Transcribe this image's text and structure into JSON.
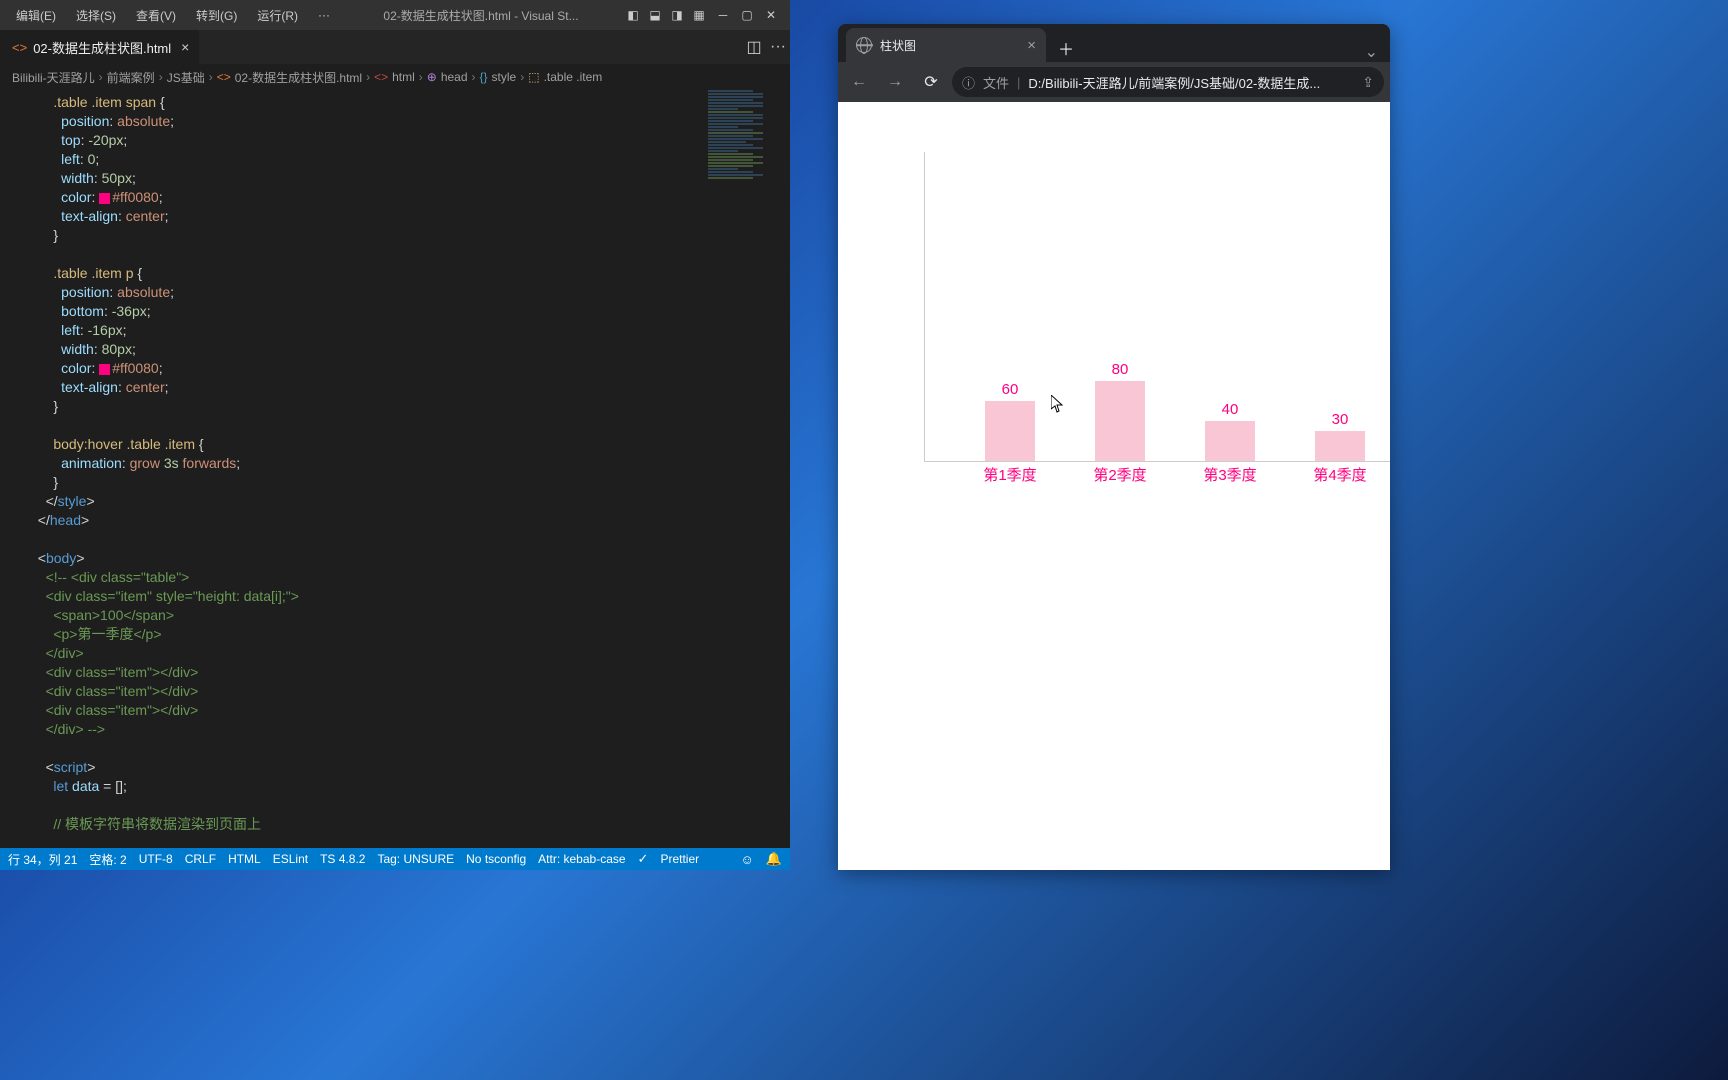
{
  "vscode": {
    "menu": [
      "编辑(E)",
      "选择(S)",
      "查看(V)",
      "转到(G)",
      "运行(R)"
    ],
    "menu_more": "···",
    "title": "02-数据生成柱状图.html - Visual St...",
    "tab": {
      "icon": "<>",
      "name": "02-数据生成柱状图.html"
    },
    "breadcrumb": [
      {
        "icon": "",
        "text": "Bilibili-天涯路儿"
      },
      {
        "icon": "",
        "text": "前端案例"
      },
      {
        "icon": "",
        "text": "JS基础"
      },
      {
        "icon": "<>",
        "cls": "ic-orange",
        "text": "02-数据生成柱状图.html"
      },
      {
        "icon": "<>",
        "cls": "ic-red",
        "text": "html"
      },
      {
        "icon": "⊕",
        "cls": "ic-purple",
        "text": "head"
      },
      {
        "icon": "{}",
        "cls": "ic-blue",
        "text": "style"
      },
      {
        "icon": "⬚",
        "cls": "ic-yellow",
        "text": ".table .item"
      }
    ],
    "code_lines": [
      "      <span class='tok-sel'>.table .item span</span> <span class='tok-punc'>{</span>",
      "        <span class='tok-prop'>position</span><span class='tok-punc'>:</span> <span class='tok-val'>absolute</span><span class='tok-punc'>;</span>",
      "        <span class='tok-prop'>top</span><span class='tok-punc'>:</span> <span class='tok-num'>-20px</span><span class='tok-punc'>;</span>",
      "        <span class='tok-prop'>left</span><span class='tok-punc'>:</span> <span class='tok-num'>0</span><span class='tok-punc'>;</span>",
      "        <span class='tok-prop'>width</span><span class='tok-punc'>:</span> <span class='tok-num'>50px</span><span class='tok-punc'>;</span>",
      "        <span class='tok-prop'>color</span><span class='tok-punc'>:</span> <span class='cswatch'></span><span class='tok-color'>#ff0080</span><span class='tok-punc'>;</span>",
      "        <span class='tok-prop'>text-align</span><span class='tok-punc'>:</span> <span class='tok-val'>center</span><span class='tok-punc'>;</span>",
      "      <span class='tok-punc'>}</span>",
      "",
      "      <span class='tok-sel'>.table .item p</span> <span class='tok-punc'>{</span>",
      "        <span class='tok-prop'>position</span><span class='tok-punc'>:</span> <span class='tok-val'>absolute</span><span class='tok-punc'>;</span>",
      "        <span class='tok-prop'>bottom</span><span class='tok-punc'>:</span> <span class='tok-num'>-36px</span><span class='tok-punc'>;</span>",
      "        <span class='tok-prop'>left</span><span class='tok-punc'>:</span> <span class='tok-num'>-16px</span><span class='tok-punc'>;</span>",
      "        <span class='tok-prop'>width</span><span class='tok-punc'>:</span> <span class='tok-num'>80px</span><span class='tok-punc'>;</span>",
      "        <span class='tok-prop'>color</span><span class='tok-punc'>:</span> <span class='cswatch'></span><span class='tok-color'>#ff0080</span><span class='tok-punc'>;</span>",
      "        <span class='tok-prop'>text-align</span><span class='tok-punc'>:</span> <span class='tok-val'>center</span><span class='tok-punc'>;</span>",
      "      <span class='tok-punc'>}</span>",
      "",
      "      <span class='tok-sel'>body:hover .table .item</span> <span class='tok-punc'>{</span>",
      "        <span class='tok-prop'>animation</span><span class='tok-punc'>:</span> <span class='tok-val'>grow</span> <span class='tok-num'>3s</span> <span class='tok-val'>forwards</span><span class='tok-punc'>;</span>",
      "      <span class='tok-punc'>}</span>",
      "    <span class='tok-punc'>&lt;/</span><span class='tok-tag'>style</span><span class='tok-punc'>&gt;</span>",
      "  <span class='tok-punc'>&lt;/</span><span class='tok-tag'>head</span><span class='tok-punc'>&gt;</span>",
      "",
      "  <span class='tok-punc'>&lt;</span><span class='tok-tag'>body</span><span class='tok-punc'>&gt;</span>",
      "    <span class='tok-cmnt'>&lt;!-- &lt;div class=\"table\"&gt;</span>",
      "    <span class='tok-cmnt'>&lt;div class=\"item\" style=\"height: data[i];\"&gt;</span>",
      "      <span class='tok-cmnt'>&lt;span&gt;100&lt;/span&gt;</span>",
      "      <span class='tok-cmnt'>&lt;p&gt;第一季度&lt;/p&gt;</span>",
      "    <span class='tok-cmnt'>&lt;/div&gt;</span>",
      "    <span class='tok-cmnt'>&lt;div class=\"item\"&gt;&lt;/div&gt;</span>",
      "    <span class='tok-cmnt'>&lt;div class=\"item\"&gt;&lt;/div&gt;</span>",
      "    <span class='tok-cmnt'>&lt;div class=\"item\"&gt;&lt;/div&gt;</span>",
      "    <span class='tok-cmnt'>&lt;/div&gt; --&gt;</span>",
      "",
      "    <span class='tok-punc'>&lt;</span><span class='tok-tag'>script</span><span class='tok-punc'>&gt;</span>",
      "      <span class='tok-kw'>let</span> <span class='tok-var'>data</span> <span class='tok-punc'>=</span> <span class='tok-punc'>[];</span>",
      "",
      "      <span class='tok-cmnt'>// 模板字符串将数据渲染到页面上</span>"
    ],
    "status": {
      "pos": "行 34，列 21",
      "spaces": "空格: 2",
      "enc": "UTF-8",
      "eol": "CRLF",
      "lang": "HTML",
      "eslint": "ESLint",
      "ts": "TS 4.8.2",
      "tag": "Tag: UNSURE",
      "tsconfig": "No tsconfig",
      "attr": "Attr: kebab-case",
      "prettier": "Prettier"
    }
  },
  "browser": {
    "tab_title": "柱状图",
    "addr_label": "文件",
    "addr_url": "D:/Bilibili-天涯路儿/前端案例/JS基础/02-数据生成..."
  },
  "chart_data": {
    "type": "bar",
    "categories": [
      "第1季度",
      "第2季度",
      "第3季度",
      "第4季度"
    ],
    "values": [
      60,
      80,
      40,
      30
    ],
    "title": "",
    "xlabel": "",
    "ylabel": "",
    "ylim": [
      0,
      300
    ],
    "bar_color": "#f8c6d4",
    "text_color": "#ff0080"
  }
}
